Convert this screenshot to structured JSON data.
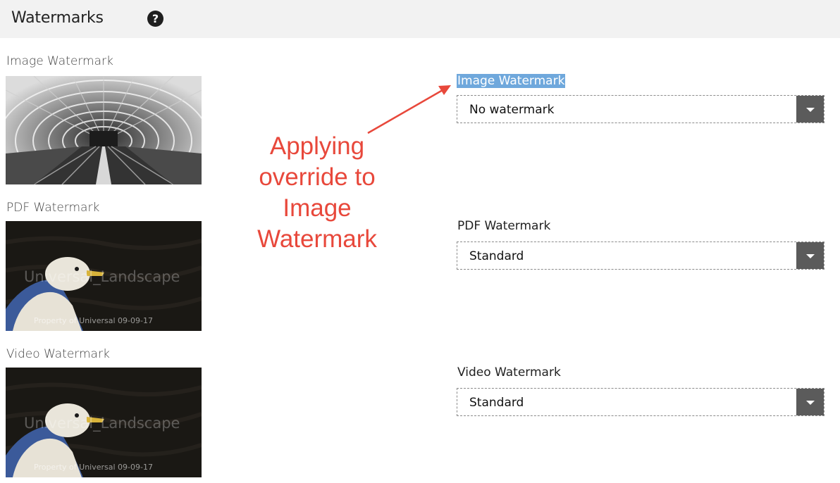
{
  "header": {
    "title": "Watermarks",
    "help_icon": "question-circle-icon",
    "help_glyph": "?"
  },
  "previews": [
    {
      "label": "Image Watermark",
      "image": "subway-station-photo"
    },
    {
      "label": "PDF Watermark",
      "image": "seagull-photo",
      "overlay_main": "Universal_Landscape",
      "overlay_sub": "Property of Universal 09-09-17"
    },
    {
      "label": "Video Watermark",
      "image": "seagull-photo",
      "overlay_main": "Universal_Landscape",
      "overlay_sub": "Property of Universal 09-09-17"
    }
  ],
  "fields": [
    {
      "label": "Image Watermark",
      "value": "No watermark",
      "highlighted": true
    },
    {
      "label": "PDF Watermark",
      "value": "Standard"
    },
    {
      "label": "Video Watermark",
      "value": "Standard"
    }
  ],
  "annotation": {
    "lines": [
      "Applying",
      "override to",
      "Image",
      "Watermark"
    ],
    "color": "#e8483b"
  },
  "colors": {
    "header_bg": "#f2f2f2",
    "highlight": "#6fa8dc",
    "caret_bg": "#5b5b5b"
  }
}
